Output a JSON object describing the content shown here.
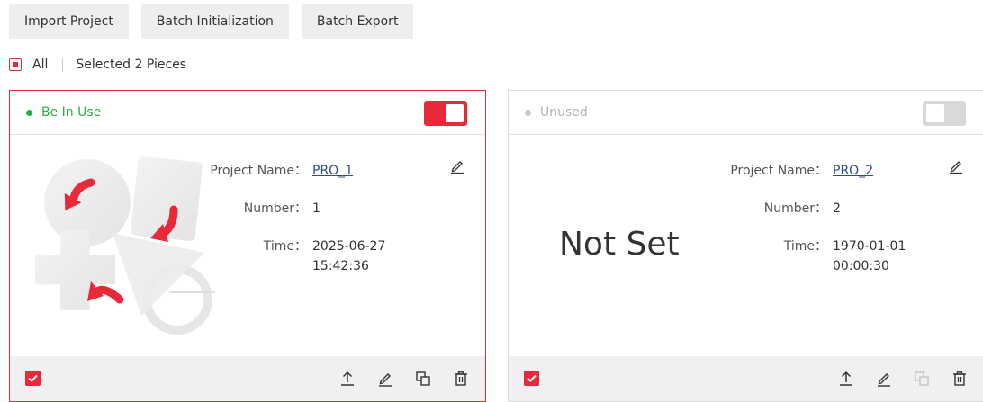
{
  "toolbar": {
    "import_label": "Import Project",
    "batch_init_label": "Batch Initialization",
    "batch_export_label": "Batch Export"
  },
  "selection": {
    "all_label": "All",
    "selected_text": "Selected 2 Pieces"
  },
  "colors": {
    "accent": "#e8293a",
    "in_use": "#23b343",
    "unused": "#b4b4b4"
  },
  "cards": [
    {
      "status": "Be In Use",
      "enabled": true,
      "fields": {
        "name_label": "Project Name：",
        "name_value": "PRO_1",
        "number_label": "Number：",
        "number_value": "1",
        "time_label": "Time：",
        "time_date": "2025-06-27",
        "time_clock": "15:42:36"
      },
      "selected": true
    },
    {
      "status": "Unused",
      "enabled": false,
      "placeholder": "Not Set",
      "fields": {
        "name_label": "Project Name：",
        "name_value": "PRO_2",
        "number_label": "Number：",
        "number_value": "2",
        "time_label": "Time：",
        "time_date": "1970-01-01",
        "time_clock": "00:00:30"
      },
      "selected": true
    }
  ]
}
